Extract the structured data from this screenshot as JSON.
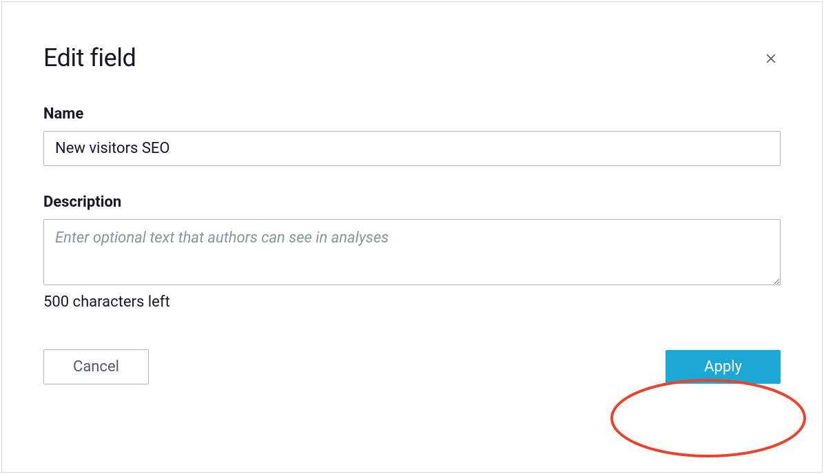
{
  "dialog": {
    "title": "Edit field",
    "name_label": "Name",
    "name_value": "New visitors SEO",
    "description_label": "Description",
    "description_placeholder": "Enter optional text that authors can see in analyses",
    "description_value": "",
    "characters_left": "500 characters left",
    "cancel_label": "Cancel",
    "apply_label": "Apply"
  }
}
